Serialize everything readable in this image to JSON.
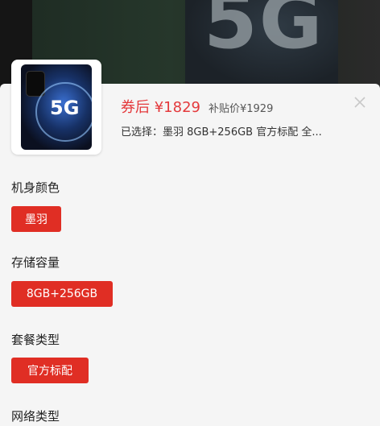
{
  "backdrop": {
    "logo_text": "5G"
  },
  "product": {
    "thumb_logo": "5G",
    "coupon_price": "券后 ¥1829",
    "subsidy_price": "补贴价¥1929",
    "selected": "已选择：墨羽 8GB+256GB 官方标配 全..."
  },
  "options": {
    "color": {
      "title": "机身颜色",
      "selected": "墨羽"
    },
    "storage": {
      "title": "存储容量",
      "selected": "8GB+256GB"
    },
    "package": {
      "title": "套餐类型",
      "selected": "官方标配"
    },
    "network": {
      "title": "网络类型"
    }
  },
  "colors": {
    "accent": "#e02e24",
    "price": "#e4393c",
    "sheet_bg": "#f5f5f5"
  },
  "icons": {
    "close": "close-icon"
  }
}
